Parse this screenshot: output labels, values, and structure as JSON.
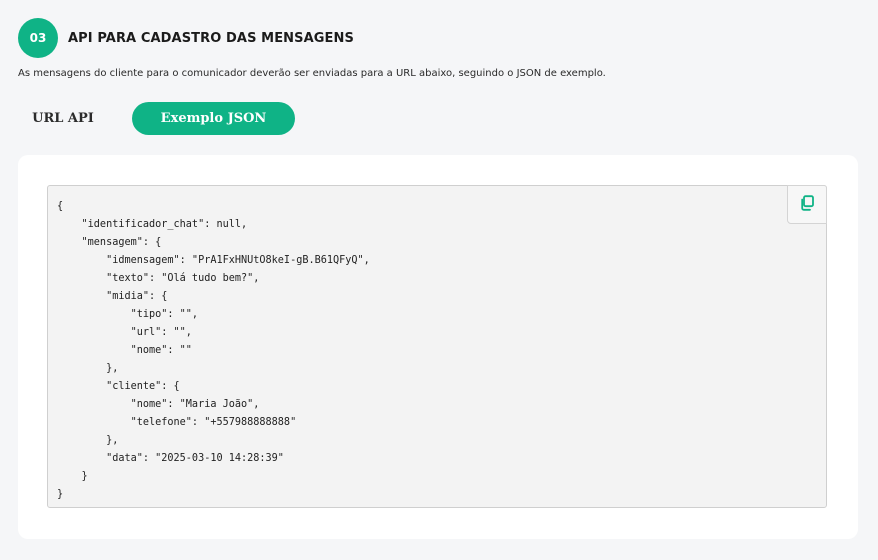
{
  "step": {
    "number": "03",
    "title": "API PARA CADASTRO DAS MENSAGENS",
    "description": "As mensagens do cliente para o comunicador deverão ser enviadas para a URL abaixo, seguindo o JSON de exemplo."
  },
  "tabs": [
    {
      "label": "URL API",
      "active": false
    },
    {
      "label": "Exemplo JSON",
      "active": true
    }
  ],
  "code_sample": "{\n    \"identificador_chat\": null,\n    \"mensagem\": {\n        \"idmensagem\": \"PrA1FxHNUtO8keI-gB.B61QFyQ\",\n        \"texto\": \"Olá tudo bem?\",\n        \"midia\": {\n            \"tipo\": \"\",\n            \"url\": \"\",\n            \"nome\": \"\"\n        },\n        \"cliente\": {\n            \"nome\": \"Maria João\",\n            \"telefone\": \"+557988888888\"\n        },\n        \"data\": \"2025-03-10 14:28:39\"\n    }\n}",
  "icons": {
    "copy": "copy-icon"
  },
  "colors": {
    "accent": "#0fb386",
    "background": "#f5f6f8",
    "panel": "#ffffff",
    "code_bg": "#f3f3f3"
  }
}
